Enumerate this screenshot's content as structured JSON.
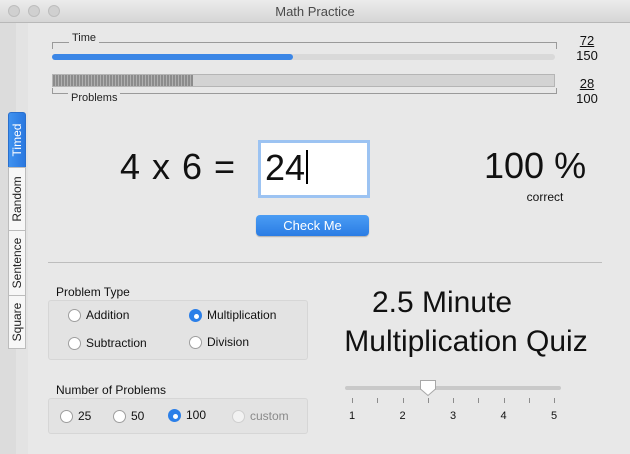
{
  "window": {
    "title": "Math Practice"
  },
  "tabs": [
    {
      "label": "Timed",
      "active": true
    },
    {
      "label": "Random",
      "active": false
    },
    {
      "label": "Sentence",
      "active": false
    },
    {
      "label": "Square",
      "active": false
    }
  ],
  "time": {
    "label": "Time",
    "value": "72",
    "total": "150",
    "fraction": 0.48
  },
  "problems": {
    "label": "Problems",
    "value": "28",
    "total": "100",
    "fraction": 0.28
  },
  "question": {
    "text": "4 x 6 =",
    "answer": "24"
  },
  "check_button": "Check Me",
  "score": {
    "value": "100 %",
    "label": "correct"
  },
  "problem_type": {
    "title": "Problem Type",
    "options": [
      "Addition",
      "Multiplication",
      "Subtraction",
      "Division"
    ],
    "selected": "Multiplication"
  },
  "num_problems": {
    "title": "Number of Problems",
    "options": [
      "25",
      "50",
      "100",
      "custom"
    ],
    "selected": "100"
  },
  "quiz_title": {
    "line1": "2.5 Minute",
    "line2": "Multiplication Quiz"
  },
  "slider": {
    "ticks": [
      "1",
      "2",
      "3",
      "4",
      "5"
    ],
    "value": 2.5,
    "min": 1,
    "max": 5
  },
  "colors": {
    "accent": "#2b7fe8",
    "progress": "#3b86e6"
  }
}
